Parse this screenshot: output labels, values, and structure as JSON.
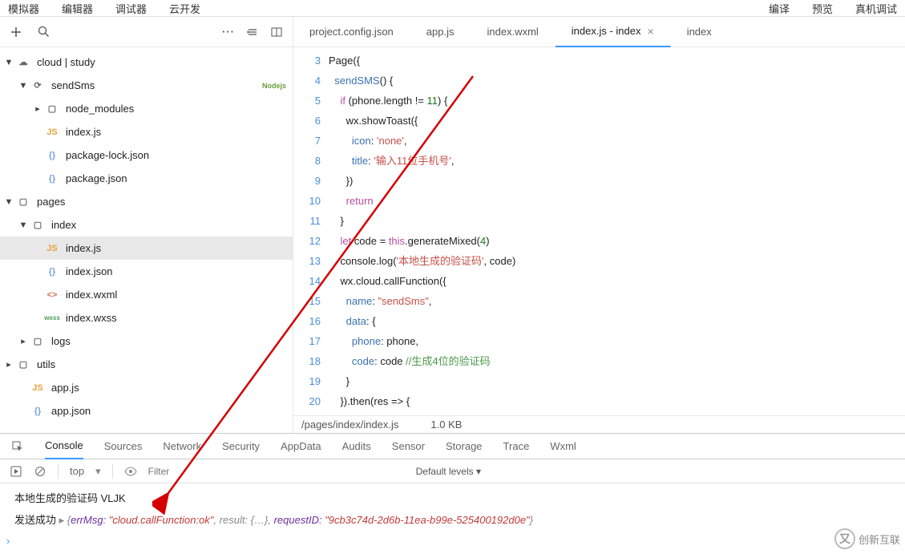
{
  "topMenu": {
    "left": [
      "模拟器",
      "编辑器",
      "调试器",
      "云开发"
    ],
    "right": [
      "编译",
      "预览",
      "真机调试"
    ]
  },
  "sidebarToolbar": {
    "dots": "···"
  },
  "tree": {
    "root_cloud": "cloud | study",
    "sendSms": "sendSms",
    "node_modules": "node_modules",
    "cloud_index_js": "index.js",
    "package_lock": "package-lock.json",
    "package_json": "package.json",
    "pages": "pages",
    "index_folder": "index",
    "index_js": "index.js",
    "index_json": "index.json",
    "index_wxml": "index.wxml",
    "index_wxss": "index.wxss",
    "logs": "logs",
    "utils": "utils",
    "app_js": "app.js",
    "app_json": "app.json",
    "nodejs": "Nodejs"
  },
  "tabs": [
    {
      "label": "project.config.json",
      "active": false
    },
    {
      "label": "app.js",
      "active": false
    },
    {
      "label": "index.wxml",
      "active": false
    },
    {
      "label": "index.js - index",
      "active": true
    },
    {
      "label": "index",
      "active": false
    }
  ],
  "code": {
    "startLine": 3,
    "lines": [
      {
        "n": 3,
        "tokens": [
          [
            "ident",
            "Page"
          ],
          [
            "punct",
            "({"
          ]
        ]
      },
      {
        "n": 4,
        "tokens": [
          [
            "pad",
            "  "
          ],
          [
            "fn",
            "sendSMS"
          ],
          [
            "punct",
            "()"
          ],
          [
            "punct",
            " {"
          ]
        ]
      },
      {
        "n": 5,
        "tokens": [
          [
            "pad",
            "    "
          ],
          [
            "kw",
            "if"
          ],
          [
            "punct",
            " (phone.length != "
          ],
          [
            "num",
            "11"
          ],
          [
            "punct",
            ") {"
          ]
        ]
      },
      {
        "n": 6,
        "tokens": [
          [
            "pad",
            "      "
          ],
          [
            "ident",
            "wx.showToast({"
          ]
        ]
      },
      {
        "n": 7,
        "tokens": [
          [
            "pad",
            "        "
          ],
          [
            "prop",
            "icon"
          ],
          [
            "punct",
            ": "
          ],
          [
            "str",
            "'none'"
          ],
          [
            "punct",
            ","
          ]
        ]
      },
      {
        "n": 8,
        "tokens": [
          [
            "pad",
            "        "
          ],
          [
            "prop",
            "title"
          ],
          [
            "punct",
            ": "
          ],
          [
            "str",
            "'输入11位手机号'"
          ],
          [
            "punct",
            ","
          ]
        ]
      },
      {
        "n": 9,
        "tokens": [
          [
            "pad",
            "      "
          ],
          [
            "punct",
            "})"
          ]
        ]
      },
      {
        "n": 10,
        "tokens": [
          [
            "pad",
            "      "
          ],
          [
            "kw",
            "return"
          ]
        ]
      },
      {
        "n": 11,
        "tokens": [
          [
            "pad",
            "    "
          ],
          [
            "punct",
            "}"
          ]
        ]
      },
      {
        "n": 12,
        "tokens": [
          [
            "pad",
            "    "
          ],
          [
            "kw",
            "let"
          ],
          [
            "ident",
            " code = "
          ],
          [
            "this",
            "this"
          ],
          [
            "ident",
            ".generateMixed("
          ],
          [
            "num",
            "4"
          ],
          [
            "punct",
            ")"
          ]
        ]
      },
      {
        "n": 13,
        "tokens": [
          [
            "pad",
            "    "
          ],
          [
            "ident",
            "console.log("
          ],
          [
            "str",
            "'本地生成的验证码'"
          ],
          [
            "ident",
            ", code)"
          ]
        ]
      },
      {
        "n": 14,
        "tokens": [
          [
            "pad",
            "    "
          ],
          [
            "ident",
            "wx.cloud.callFunction({"
          ]
        ]
      },
      {
        "n": 15,
        "tokens": [
          [
            "pad",
            "      "
          ],
          [
            "prop",
            "name"
          ],
          [
            "punct",
            ": "
          ],
          [
            "str",
            "\"sendSms\""
          ],
          [
            "punct",
            ","
          ]
        ]
      },
      {
        "n": 16,
        "tokens": [
          [
            "pad",
            "      "
          ],
          [
            "prop",
            "data"
          ],
          [
            "punct",
            ": {"
          ]
        ]
      },
      {
        "n": 17,
        "tokens": [
          [
            "pad",
            "        "
          ],
          [
            "prop",
            "phone"
          ],
          [
            "punct",
            ": phone,"
          ]
        ]
      },
      {
        "n": 18,
        "tokens": [
          [
            "pad",
            "        "
          ],
          [
            "prop",
            "code"
          ],
          [
            "punct",
            ": code "
          ],
          [
            "cmt",
            "//生成4位的验证码"
          ]
        ]
      },
      {
        "n": 19,
        "tokens": [
          [
            "pad",
            "      "
          ],
          [
            "punct",
            "}"
          ]
        ]
      },
      {
        "n": 20,
        "tokens": [
          [
            "pad",
            "    "
          ],
          [
            "ident",
            "}).then(res => {"
          ]
        ]
      }
    ]
  },
  "statusBar": {
    "path": "/pages/index/index.js",
    "size": "1.0 KB"
  },
  "devtools": {
    "tabs": [
      "Console",
      "Sources",
      "Network",
      "Security",
      "AppData",
      "Audits",
      "Sensor",
      "Storage",
      "Trace",
      "Wxml"
    ],
    "activeTab": "Console",
    "context": "top",
    "filterPlaceholder": "Filter",
    "levels": "Default levels ▾",
    "log1_prefix": "本地生成的验证码",
    "log1_value": "VLJK",
    "log2_prefix": "发送成功",
    "log2_obj_open": "{",
    "log2_k1": "errMsg: ",
    "log2_v1": "\"cloud.callFunction:ok\"",
    "log2_mid": ", result: {…}, ",
    "log2_k2": "requestID: ",
    "log2_v2": "\"9cb3c74d-2d6b-11ea-b99e-525400192d0e\"",
    "log2_close": "}"
  },
  "brand": {
    "text": "创新互联"
  }
}
